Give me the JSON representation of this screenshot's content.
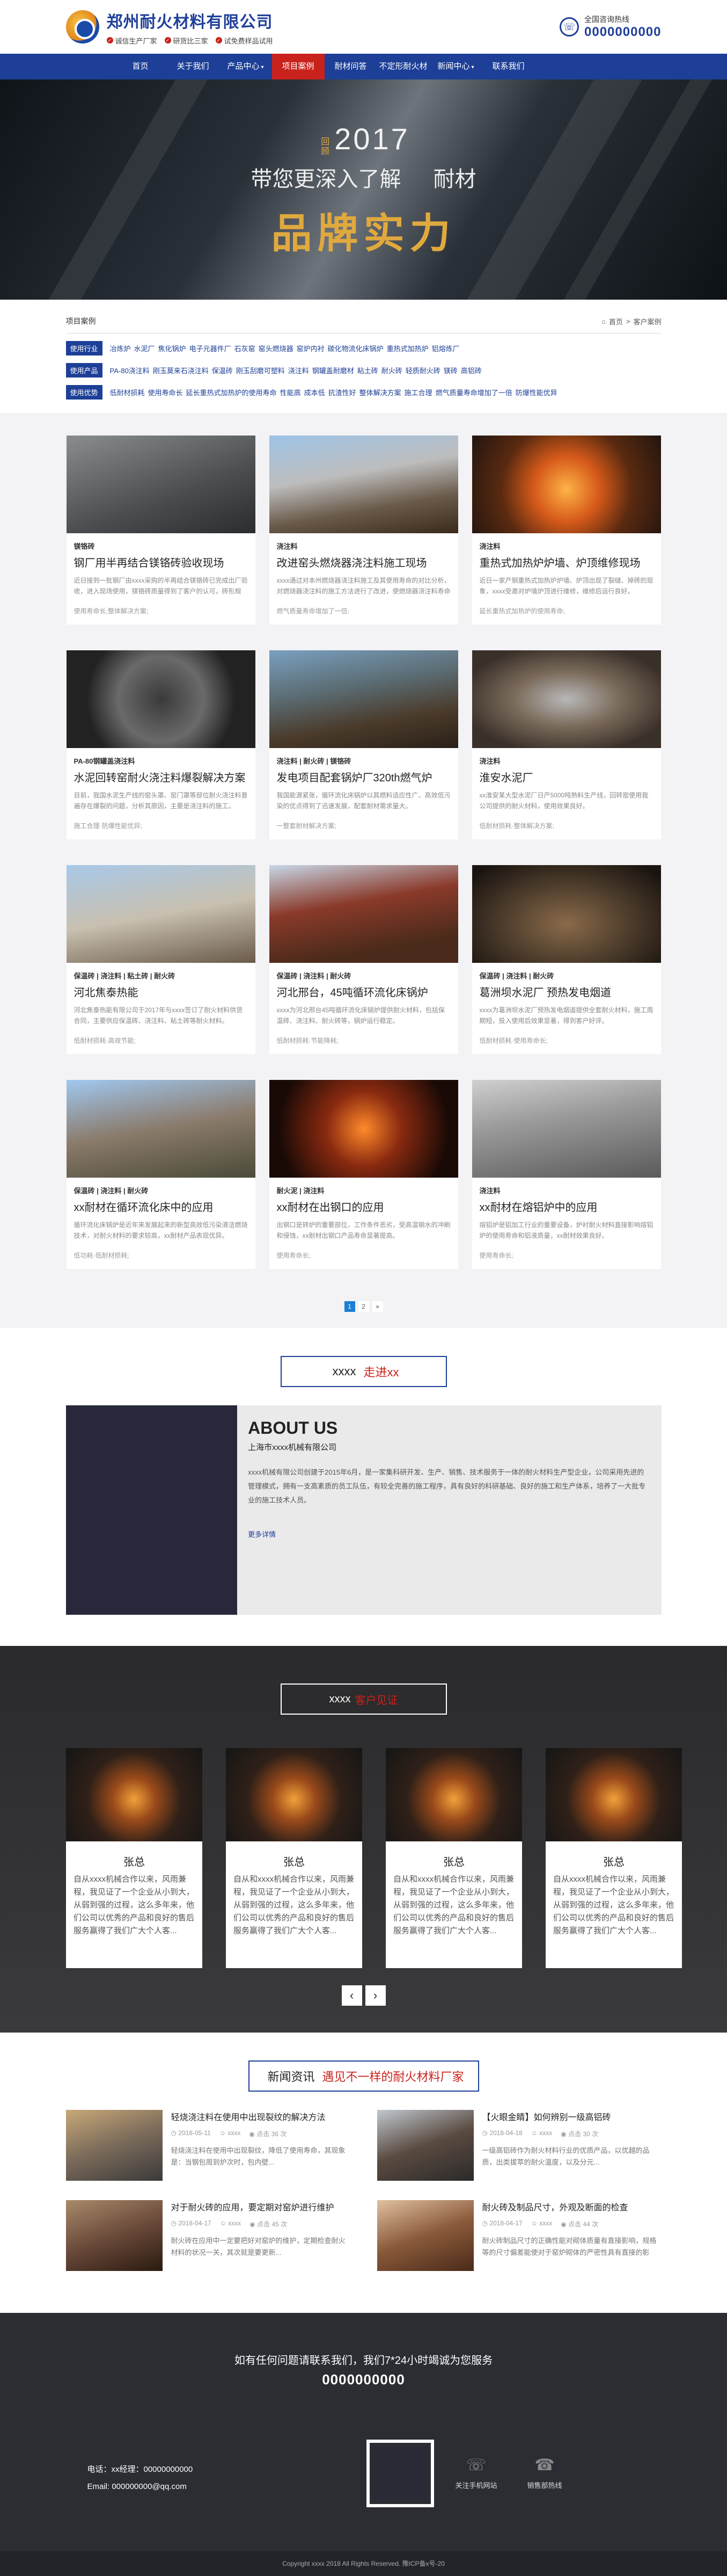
{
  "header": {
    "title": "郑州耐火材料有限公司",
    "slogans": [
      "诚信生产厂家",
      "研货比三家",
      "试免费样品试用"
    ],
    "hotline_label": "全国咨询热线",
    "hotline_number": "0000000000"
  },
  "nav": {
    "items": [
      {
        "label": "首页",
        "caret": false,
        "active": false
      },
      {
        "label": "关于我们",
        "caret": false,
        "active": false
      },
      {
        "label": "产品中心",
        "caret": true,
        "active": false
      },
      {
        "label": "项目案例",
        "caret": false,
        "active": true
      },
      {
        "label": "耐材问答",
        "caret": false,
        "active": false
      },
      {
        "label": "不定形耐火材料",
        "caret": false,
        "active": false
      },
      {
        "label": "新闻中心",
        "caret": true,
        "active": false
      },
      {
        "label": "联系我们",
        "caret": false,
        "active": false
      }
    ]
  },
  "banner": {
    "small": "回顾",
    "year": "2017",
    "line_left": "带您更深入了解",
    "line_right": "耐材",
    "big": "品牌实力"
  },
  "cases": {
    "title": "项目案例",
    "breadcrumb": [
      "首页",
      "客户案例"
    ],
    "filters": [
      {
        "label": "使用行业",
        "items": [
          "冶炼炉",
          "水泥厂",
          "焦化锅炉",
          "电子元器件厂",
          "石灰窑",
          "窑头燃烧器",
          "窑炉内衬",
          "碳化物流化床锅炉",
          "重热式加热炉",
          "铝熔炼厂"
        ]
      },
      {
        "label": "使用产品",
        "items": [
          "PA-80浇注料",
          "刚玉莫来石浇注料",
          "保温砖",
          "刚玉刮磨可塑料",
          "浇注料",
          "钢罐盖耐磨材",
          "粘土砖",
          "耐火砖",
          "轻质耐火砖",
          "镁砖",
          "高铝砖"
        ]
      },
      {
        "label": "使用优势",
        "items": [
          "低耐材损耗",
          "使用寿命长",
          "延长重热式加热炉的使用寿命",
          "性能高",
          "成本低",
          "抗渣性好",
          "整体解决方案",
          "施工合理",
          "燃气质量寿命增加了一倍",
          "防爆性能优异"
        ]
      }
    ]
  },
  "products": [
    {
      "tags": "镁铬砖",
      "title": "钢厂用半再结合镁铬砖验收现场",
      "desc": "近日接到一批钢厂由xxxx采购的半再结合镁铬砖已完成出厂验收，进入现场使用，镁铬砖质量得到了客户的认可，砖形规整。",
      "more": "使用寿命长,整体解决方案;"
    },
    {
      "tags": "浇注料",
      "title": "改进窑头燃烧器浇注料施工现场",
      "desc": "xxxx通过对本州燃烧器浇注料施工及其使用寿命的对比分析，对燃烧器浇注料的施工方法进行了改进，使燃烧器浇注料寿命提高。",
      "more": "燃气质量寿命增加了一倍;"
    },
    {
      "tags": "浇注料",
      "title": "重热式加热炉炉墙、炉顶维修现场",
      "desc": "近日一家产钢重热式加热炉炉墙、炉顶出现了裂缝、掉砖的现象，xxxx受邀对炉墙炉顶进行维修，维修后运行良好。",
      "more": "延长重热式加热炉的使用寿命;"
    },
    {
      "tags": "PA-80钢罐盖浇注料",
      "title": "水泥回转窑耐火浇注料爆裂解决方案",
      "desc": "目前，我国水泥生产线的窑头罩、窑门罩等部位耐火浇注料普遍存在爆裂的问题，分析其原因，主要是浇注料的施工。",
      "more": "施工合理·防爆性能优异;"
    },
    {
      "tags": "浇注料 | 耐火砖 | 镁铬砖",
      "title": "发电项目配套锅炉厂320th燃气炉",
      "desc": "我国能源紧张，循环流化床锅炉以其燃料适应性广、高效低污染的优点得到了迅速发展，配套耐材需求量大。",
      "more": "一整套耐材解决方案;"
    },
    {
      "tags": "浇注料",
      "title": "淮安水泥厂",
      "desc": "xx淮安某大型水泥厂日产5000吨熟料生产线，回转窑使用我公司提供的耐火材料，使用效果良好。",
      "more": "低耐材损耗·整体解决方案;"
    },
    {
      "tags": "保温砖 | 浇注料 | 粘土砖 | 耐火砖",
      "title": "河北焦泰热能",
      "desc": "河北焦泰热能有限公司于2017年与xxxx签订了耐火材料供货合同，主要供应保温砖、浇注料、粘土砖等耐火材料。",
      "more": "低耐材损耗·高效节能;"
    },
    {
      "tags": "保温砖 | 浇注料 | 耐火砖",
      "title": "河北邢台，45吨循环流化床锅炉",
      "desc": "xxxx为河北邢台45吨循环流化床锅炉提供耐火材料，包括保温砖、浇注料、耐火砖等，锅炉运行稳定。",
      "more": "低耐材损耗·节能降耗;"
    },
    {
      "tags": "保温砖 | 浇注料 | 耐火砖",
      "title": "葛洲坝水泥厂 预热发电烟道",
      "desc": "xxxx为葛洲坝水泥厂预热发电烟道提供全套耐火材料，施工周期短，投入使用后效果显著，得到客户好评。",
      "more": "低耐材损耗·使用寿命长;"
    },
    {
      "tags": "保温砖 | 浇注料 | 耐火砖",
      "title": "xx耐材在循环流化床中的应用",
      "desc": "循环流化床锅炉是近年来发展起来的新型高效低污染清洁燃烧技术，对耐火材料的要求较高，xx耐材产品表现优异。",
      "more": "低功耗·低耐材损耗;"
    },
    {
      "tags": "耐火泥 | 浇注料",
      "title": "xx耐材在出钢口的应用",
      "desc": "出钢口是转炉的重要部位，工作条件恶劣，受高温钢水的冲刷和侵蚀，xx耐材出钢口产品寿命显著提高。",
      "more": "使用寿命长;"
    },
    {
      "tags": "浇注料",
      "title": "xx耐材在熔铝炉中的应用",
      "desc": "熔铝炉是铝加工行业的重要设备，炉衬耐火材料直接影响熔铝炉的使用寿命和铝液质量，xx耐材效果良好。",
      "more": "使用寿命长;"
    }
  ],
  "pager": [
    "1",
    "2",
    "»"
  ],
  "about_head": {
    "en": "xxxx",
    "cn": "走进xx"
  },
  "about": {
    "title": "ABOUT US",
    "company": "上海市xxxx机械有限公司",
    "desc": "xxxx机械有限公司创建于2015年6月，是一家集科研开发、生产、销售、技术服务于一体的耐火材料生产型企业，公司采用先进的管理模式，拥有一支高素质的员工队伍，有较全完善的施工程序，具有良好的科研基础、良好的施工和生产体系，培养了一大批专业的施工技术人员。",
    "more": "更多详情"
  },
  "customers_head": {
    "en": "xxxx",
    "cn": "客户见证"
  },
  "customers": [
    {
      "name": "张总",
      "desc": "自从xxxx机械合作以来，风雨兼程，我见证了一个企业从小到大，从弱到强的过程，这么多年来，他们公司以优秀的产品和良好的售后服务赢得了我们广大个人客..."
    },
    {
      "name": "张总",
      "desc": "自从和xxxx机械合作以来，风雨兼程，我见证了一个企业从小到大，从弱到强的过程，这么多年来，他们公司以优秀的产品和良好的售后服务赢得了我们广大个人客..."
    },
    {
      "name": "张总",
      "desc": "自从和xxxx机械合作以来，风雨兼程，我见证了一个企业从小到大，从弱到强的过程，这么多年来，他们公司以优秀的产品和良好的售后服务赢得了我们广大个人客..."
    },
    {
      "name": "张总",
      "desc": "自从xxxx机械合作以来，风雨兼程，我见证了一个企业从小到大，从弱到强的过程，这么多年来，他们公司以优秀的产品和良好的售后服务赢得了我们广大个人客..."
    }
  ],
  "cust_arrows": {
    "prev": "‹",
    "next": "›"
  },
  "news_head": {
    "en": "新闻资讯",
    "cn": "遇见不一样的耐火材料厂家"
  },
  "news": [
    {
      "title": "轻烧浇注料在使用中出现裂纹的解决方法",
      "date": "2018-05-11",
      "author": "xxxx",
      "views": "点击 36 次",
      "desc": "轻烧浇注料在使用中出现裂纹，降低了使用寿命，其现象是：当钢包周到炉次时，包内壁..."
    },
    {
      "title": "【火眼金睛】如何辨别一级高铝砖",
      "date": "2018-04-18",
      "author": "xxxx",
      "views": "点击 30 次",
      "desc": "一级高铝砖作为耐火材料行业的优质产品，以优越的品质，出类拔萃的耐火温度，以及分元..."
    },
    {
      "title": "对于耐火砖的应用，要定期对窑炉进行维护",
      "date": "2018-04-17",
      "author": "xxxx",
      "views": "点击 45 次",
      "desc": "耐火砖在应用中一定要把好对窑炉的维护，定期检查耐火材料的状况一关，其次就是要更新..."
    },
    {
      "title": "耐火砖及制品尺寸，外观及断面的检查",
      "date": "2018-04-17",
      "author": "xxxx",
      "views": "点击 44 次",
      "desc": "耐火砖制品尺寸的正确性能对砌体质量有直接影响，规格等的尺寸偏差能使对于窑炉砌体的严密性具有直接的影响，而耐火的..."
    }
  ],
  "footer": {
    "question": "如有任何问题请联系我们，我们7*24小时竭诚为您服务",
    "phone": "0000000000",
    "contact_phone": "电话：xx经理：00000000000",
    "contact_email": "Email: 000000000@qq.com",
    "icons": [
      {
        "glyph": "☏",
        "label": "关注手机网站"
      },
      {
        "glyph": "☎",
        "label": "销售部热线"
      }
    ],
    "copyright": "Copyright xxxx 2018 All Rights Reserved. 豫ICP备x号-20"
  },
  "colors": {
    "brand_blue": "#1d3f97",
    "accent_red": "#c9221c",
    "gold": "#e0a93e"
  }
}
